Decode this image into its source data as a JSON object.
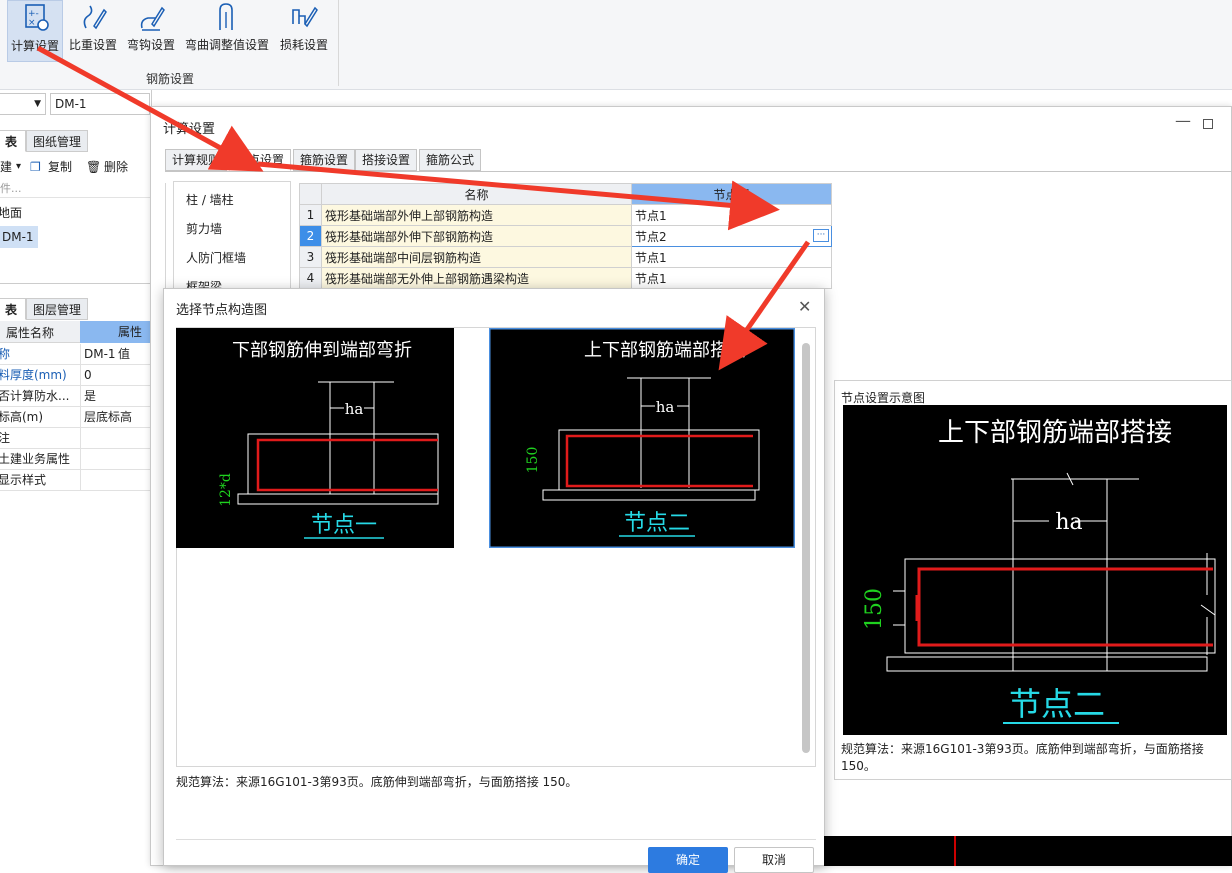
{
  "ribbon": {
    "buttons": [
      {
        "label": "计算设置",
        "icon": "calc-settings-icon",
        "selected": true
      },
      {
        "label": "比重设置",
        "icon": "density-settings-icon"
      },
      {
        "label": "弯钩设置",
        "icon": "hook-settings-icon"
      },
      {
        "label": "弯曲调整值设置",
        "icon": "bend-adjust-icon"
      },
      {
        "label": "损耗设置",
        "icon": "loss-settings-icon"
      }
    ],
    "group_label": "钢筋设置"
  },
  "left": {
    "combo_value": "DM-1",
    "tabs_top": [
      "表",
      "图纸管理"
    ],
    "toolbar": {
      "new_label": "建",
      "copy_label": "复制",
      "delete_label": "删除"
    },
    "search_placeholder": "件...",
    "tree": [
      "地面",
      "DM-1"
    ],
    "tabs_bottom": [
      "表",
      "图层管理"
    ],
    "prop_headers": [
      "属性名称",
      "属性值"
    ],
    "props": [
      {
        "name": "称",
        "value": "DM-1",
        "blue": true
      },
      {
        "name": "料厚度(mm)",
        "value": "0",
        "blue": true
      },
      {
        "name": "否计算防水...",
        "value": "是",
        "blue": false
      },
      {
        "name": "标高(m)",
        "value": "层底标高",
        "blue": false
      },
      {
        "name": "注",
        "value": "",
        "blue": false
      },
      {
        "name": "土建业务属性",
        "value": "",
        "blue": false
      },
      {
        "name": "显示样式",
        "value": "",
        "blue": false
      }
    ]
  },
  "calc_dialog": {
    "title": "计算设置",
    "tabs": [
      "计算规则",
      "节点设置",
      "箍筋设置",
      "搭接设置",
      "箍筋公式"
    ],
    "active_tab": 1,
    "categories": [
      "柱 / 墙柱",
      "剪力墙",
      "人防门框墙",
      "框架梁"
    ],
    "table": {
      "headers": [
        "",
        "名称",
        "节点图"
      ],
      "rows": [
        {
          "num": "1",
          "name": "筏形基础端部外伸上部钢筋构造",
          "value": "节点1"
        },
        {
          "num": "2",
          "name": "筏形基础端部外伸下部钢筋构造",
          "value": "节点2"
        },
        {
          "num": "3",
          "name": "筏形基础端部中间层钢筋构造",
          "value": "节点1"
        },
        {
          "num": "4",
          "name": "筏形基础端部无外伸上部钢筋遇梁构造",
          "value": "节点1"
        }
      ],
      "selected_row": 1
    }
  },
  "preview": {
    "panel_title": "节点设置示意图",
    "image_title": "上下部钢筋端部搭接",
    "dim_ha": "ha",
    "dim_150": "150",
    "node_label": "节点二",
    "description": "规范算法：来源16G101-3第93页。底筋伸到端部弯折，与面筋搭接 150。"
  },
  "select_dialog": {
    "title": "选择节点构造图",
    "options": [
      {
        "title": "下部钢筋伸到端部弯折",
        "dim_ha": "ha",
        "dim_side": "12*d",
        "label": "节点一"
      },
      {
        "title": "上下部钢筋端部搭接",
        "dim_ha": "ha",
        "dim_side": "150",
        "label": "节点二"
      }
    ],
    "description": "规范算法：来源16G101-3第93页。底筋伸到端部弯折，与面筋搭接 150。",
    "ok_label": "确定",
    "cancel_label": "取消"
  },
  "colors": {
    "accent": "#2d7be0",
    "rebar": "#e01b1b",
    "dim_green": "#1fd11f",
    "label_cyan": "#26d9e6"
  }
}
